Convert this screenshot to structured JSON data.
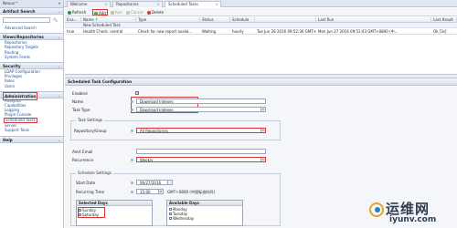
{
  "topbar": {
    "brand": "Nexus™",
    "brand_arrow": "▾"
  },
  "sidebar": {
    "sections": {
      "artifact_search": "Artifact Search",
      "views": "Views/Repositories",
      "security": "Security",
      "administration": "Administration",
      "help": "Help"
    },
    "chevron": "⌄",
    "search_button": "🔍",
    "advanced_search": "Advanced Search",
    "views_links": [
      "Repositories",
      "Repository Targets",
      "Routing",
      "System Feeds"
    ],
    "security_links": [
      "LDAP Configuration",
      "Privileges",
      "Roles",
      "Users"
    ],
    "admin_links": [
      "Analytics",
      "Capabilities",
      "Logging",
      "Plugin Console",
      "Scheduled Tasks",
      "Server",
      "Support Tools"
    ]
  },
  "tabs": [
    {
      "label": "Welcome",
      "close": "×"
    },
    {
      "label": "Repositories",
      "close": "×"
    },
    {
      "label": "Scheduled Tasks",
      "close": "×"
    }
  ],
  "toolbar": {
    "refresh": "Refresh",
    "add": "Add",
    "run": "Run",
    "cancel": "Cancel",
    "delete": "Delete"
  },
  "grid": {
    "columns": [
      "Ena...",
      "Name ↑",
      "Type",
      "Status",
      "Schedule",
      "Last Run",
      "Last Result"
    ],
    "group_label": "New Scheduled Task",
    "rows": [
      [
        "true",
        "Health Check: central",
        "Check for new report availa...",
        "Waiting",
        "hourly",
        "Tue Jun 28 2016 09:52:30 GMT+0800 (中...",
        "Mon Jun 27 2016 09:51:03 GMT+0800 (中...",
        "Ok [3s]"
      ]
    ]
  },
  "config": {
    "title": "Scheduled Task Configuration",
    "enabled_label": "Enabled",
    "enabled_mark": "✓",
    "name_label": "Name",
    "name_value": "Download Indexes",
    "task_type_label": "Task Type",
    "task_type_value": "Download Indexes",
    "dropdown_arrow": "▾",
    "task_settings_legend": "Task Settings",
    "repo_group_label": "Repository/Group",
    "repo_group_value": "All Repositories",
    "alert_email_label": "Alert Email",
    "recurrence_label": "Recurrence",
    "recurrence_value": "Weekly",
    "schedule_legend": "Schedule Settings",
    "start_date_label": "Start Date",
    "start_date_value": "06/27/2016",
    "recurring_time_label": "Recurring Time",
    "recurring_time_value": "15:00",
    "timezone_text": "GMT+0800 (中国标准时间)",
    "selected_days_header": "Selected Days",
    "selected_days": [
      "Sunday",
      "Saturday"
    ],
    "available_days_header": "Available Days",
    "available_days": [
      "Monday",
      "Tuesday",
      "Wednesday"
    ]
  },
  "watermark": {
    "cn": "运维网",
    "en": "iyunv.com"
  },
  "colors": {
    "highlight": "#dd3333",
    "header_bg": "#dbe4f1",
    "link": "#1e4f9a"
  }
}
